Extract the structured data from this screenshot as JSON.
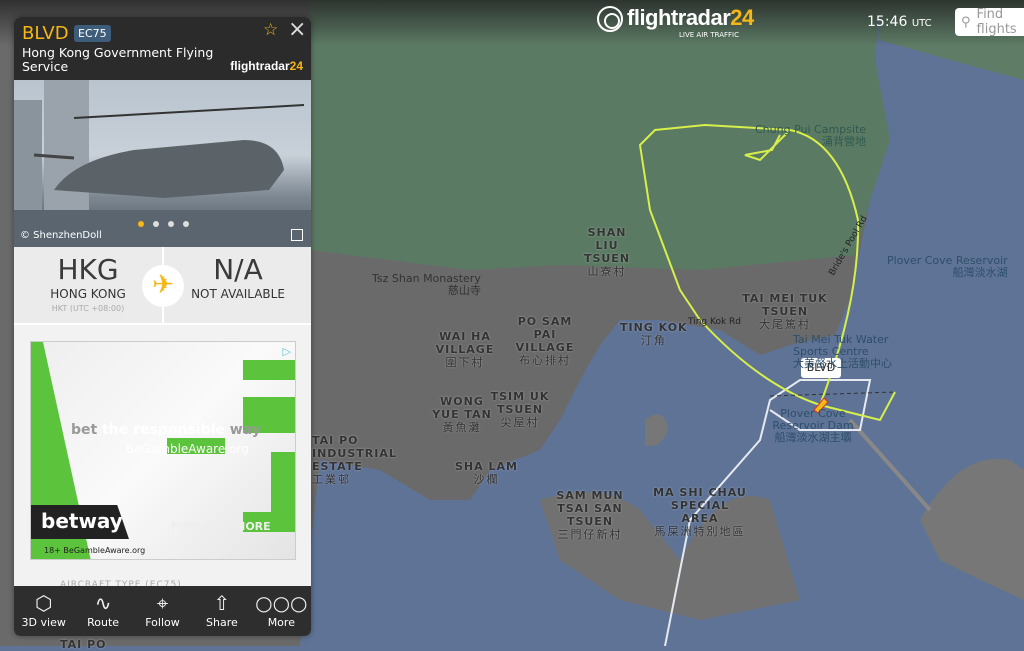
{
  "header": {
    "brand": "flightradar",
    "brand_num": "24",
    "tagline": "LIVE AIR TRAFFIC",
    "time": "15:46",
    "time_unit": "UTC",
    "search_placeholder": "Find flights"
  },
  "panel": {
    "callsign": "BLVD",
    "aircraft_code": "EC75",
    "operator": "Hong Kong Government Flying Service",
    "fr_logo": "flightradar",
    "fr_logo_num": "24",
    "photo_credit": "© ShenzhenDoll",
    "origin": {
      "code": "HKG",
      "city": "HONG KONG",
      "tz": "HKT (UTC +08:00)"
    },
    "destination": {
      "code": "N/A",
      "city": "NOT AVAILABLE"
    },
    "aircraft_type_label": "AIRCRAFT TYPE (EC75)",
    "ad": {
      "tagline_a": "bet",
      "tagline_b": "the responsible",
      "tagline_c": "way",
      "sub": "BeGambleAware.org",
      "brand": "betway",
      "cta": "FIND OUT MORE",
      "footer": "18+ BeGambleAware.org",
      "accent": "#5cc33c"
    },
    "toolbar": [
      {
        "label": "3D view",
        "icon": "cube-lock-icon"
      },
      {
        "label": "Route",
        "icon": "route-icon"
      },
      {
        "label": "Follow",
        "icon": "follow-icon"
      },
      {
        "label": "Share",
        "icon": "share-icon"
      },
      {
        "label": "More",
        "icon": "more-icon"
      }
    ]
  },
  "map": {
    "aircraft_label": "BLVD",
    "track_color": "#d7ef4a",
    "places": [
      {
        "en": "SHAN LIU TSUEN",
        "zh": "山寮村"
      },
      {
        "en": "TAI MEI TUK TSUEN",
        "zh": "大尾篤村"
      },
      {
        "en": "TING KOK",
        "zh": "汀角"
      },
      {
        "en": "PO SAM PAI VILLAGE",
        "zh": "布心排村"
      },
      {
        "en": "WAI HA VILLAGE",
        "zh": "圍下村"
      },
      {
        "en": "WONG YUE TAN",
        "zh": "黃魚灘"
      },
      {
        "en": "TSIM UK TSUEN",
        "zh": "尖屋村"
      },
      {
        "en": "SHA LAM",
        "zh": "沙欄"
      },
      {
        "en": "SAM MUN TSAI SAN TSUEN",
        "zh": "三門仔新村"
      },
      {
        "en": "MA SHI CHAU SPECIAL AREA",
        "zh": "馬屎洲特別地區"
      },
      {
        "en": "TAI PO INDUSTRIAL ESTATE",
        "zh": "工業邨"
      },
      {
        "en": "TAI PO",
        "zh": ""
      }
    ],
    "pois": [
      {
        "en": "Chung Pui Campsite",
        "zh": "涌背營地"
      },
      {
        "en": "Tsz Shan Monastery",
        "zh": "慈山寺"
      },
      {
        "en": "Plover Cove Reservoir",
        "zh": "船灣淡水湖"
      },
      {
        "en": "Tai Mei Tuk Water Sports Centre",
        "zh": "大美督水上活動中心"
      },
      {
        "en": "Plover Cove Reservoir Dam",
        "zh": "船灣淡水湖主壩"
      }
    ],
    "roads": [
      "Ting Kok Rd",
      "Bride's Pool Rd"
    ]
  }
}
